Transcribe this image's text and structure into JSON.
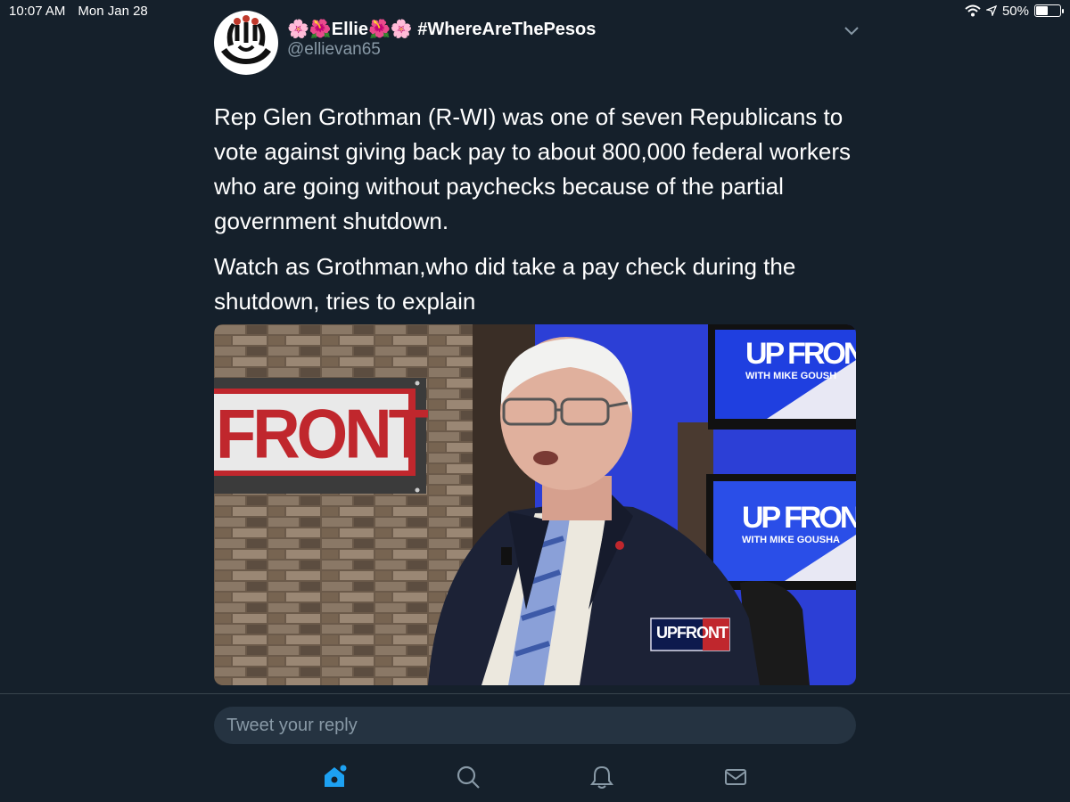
{
  "status_bar": {
    "time": "10:07 AM",
    "date": "Mon Jan 28",
    "battery_label": "50%",
    "battery_level": 0.5
  },
  "tweet": {
    "display_name": "🌸🌺Ellie🌺🌸 #WhereAreThePesos",
    "handle": "@ellievan65",
    "paragraphs": [
      "Rep Glen Grothman (R-WI) was one of seven Republicans to vote against giving back pay to about 800,000 federal workers who are going without paychecks because of the partial government shutdown.",
      "Watch as Grothman,who did take a pay check during the shutdown, tries to explain"
    ]
  },
  "video": {
    "wall_sign": "FRONT",
    "monitor_top_title": "UP FRONT",
    "monitor_top_subtitle": "WITH MIKE GOUSH",
    "monitor_bottom_title": "UP FRONT",
    "monitor_bottom_subtitle": "WITH MIKE GOUSHA",
    "watermark_up": "UP",
    "watermark_front": "FRONT"
  },
  "reply": {
    "placeholder": "Tweet your reply"
  },
  "tabs": [
    {
      "icon": "home-icon",
      "active": true
    },
    {
      "icon": "search-icon",
      "active": false
    },
    {
      "icon": "notifications-icon",
      "active": false
    },
    {
      "icon": "messages-icon",
      "active": false
    }
  ],
  "colors": {
    "background": "#15202b",
    "accent": "#1da1f2",
    "secondary_text": "#8899a6"
  }
}
